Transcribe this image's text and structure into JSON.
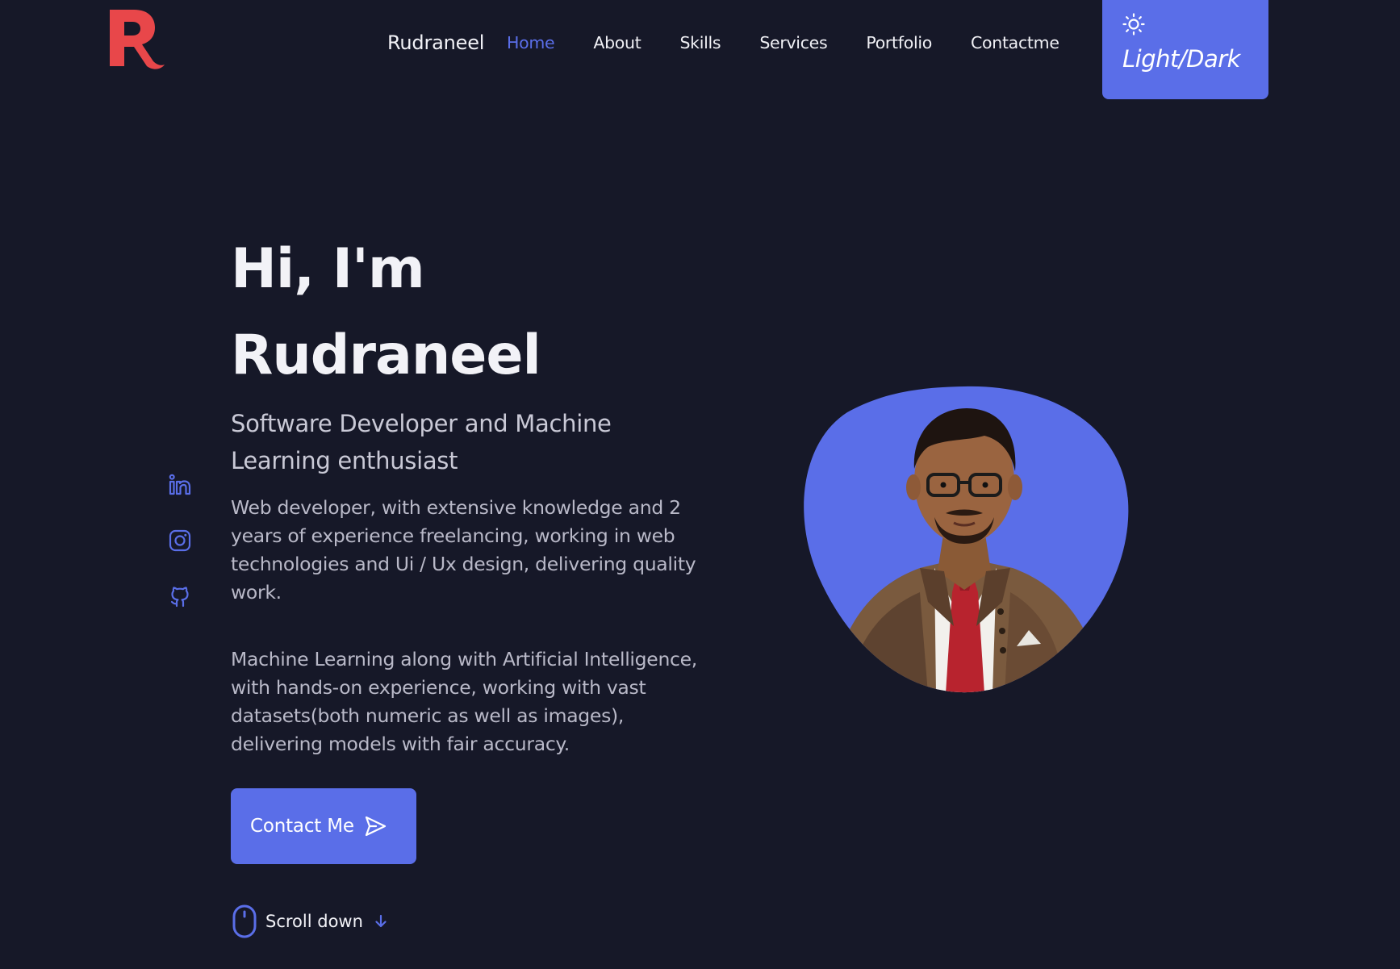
{
  "header": {
    "brand": "Rudraneel",
    "logo_letter": "R",
    "nav": [
      {
        "label": "Home",
        "active": true
      },
      {
        "label": "About",
        "active": false
      },
      {
        "label": "Skills",
        "active": false
      },
      {
        "label": "Services",
        "active": false
      },
      {
        "label": "Portfolio",
        "active": false
      },
      {
        "label": "Contactme",
        "active": false
      }
    ],
    "theme_toggle_label": "Light/Dark",
    "theme_icon": "sun-icon"
  },
  "socials": [
    {
      "name": "linkedin-icon"
    },
    {
      "name": "instagram-icon"
    },
    {
      "name": "github-icon"
    }
  ],
  "hero": {
    "greeting": "Hi, I'm",
    "name": "Rudraneel",
    "subtitle": "Software Developer and Machine Learning enthusiast",
    "description_1": "Web developer, with extensive knowledge and 2 years of experience freelancing, working in web technologies and Ui / Ux design, delivering quality work.",
    "description_2": "Machine Learning along with Artificial Intelligence, with hands-on experience, working with vast datasets(both numeric as well as images), delivering models with fair accuracy.",
    "contact_button": "Contact Me",
    "scroll_label": "Scroll down"
  },
  "colors": {
    "background": "#161828",
    "accent": "#5a6ee8",
    "logo": "#e8474a",
    "text": "#f2f2f7"
  }
}
